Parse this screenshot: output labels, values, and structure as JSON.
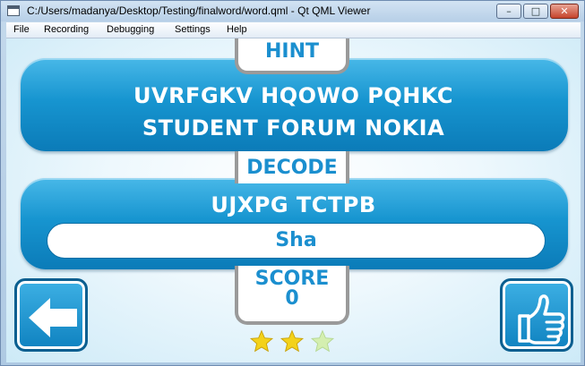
{
  "window": {
    "title": "C:/Users/madanya/Desktop/Testing/finalword/word.qml - Qt QML Viewer",
    "minimize_glyph": "–",
    "maximize_glyph": "□",
    "close_glyph": "✕"
  },
  "menu": {
    "items": [
      "File",
      "Recording",
      "Debugging",
      "Settings",
      "Help"
    ]
  },
  "hint": {
    "label": "HINT",
    "line1": "UVRFGKV HQOWO PQHKC",
    "line2": "STUDENT FORUM NOKIA"
  },
  "decode": {
    "label": "DECODE",
    "cipher": "UJXPG TCTPB",
    "answer_value": "Sha"
  },
  "score": {
    "label": "SCORE",
    "value": "0"
  },
  "stars": {
    "filled": 2,
    "total": 3,
    "filled_color": "#f3d21a",
    "empty_color": "#d4efb0"
  },
  "buttons": {
    "back_icon": "left-arrow-icon",
    "submit_icon": "thumbs-up-icon"
  },
  "colors": {
    "panel_blue": "#1795d0",
    "label_blue": "#1b8fcf",
    "tab_border": "#9a9a9a"
  }
}
